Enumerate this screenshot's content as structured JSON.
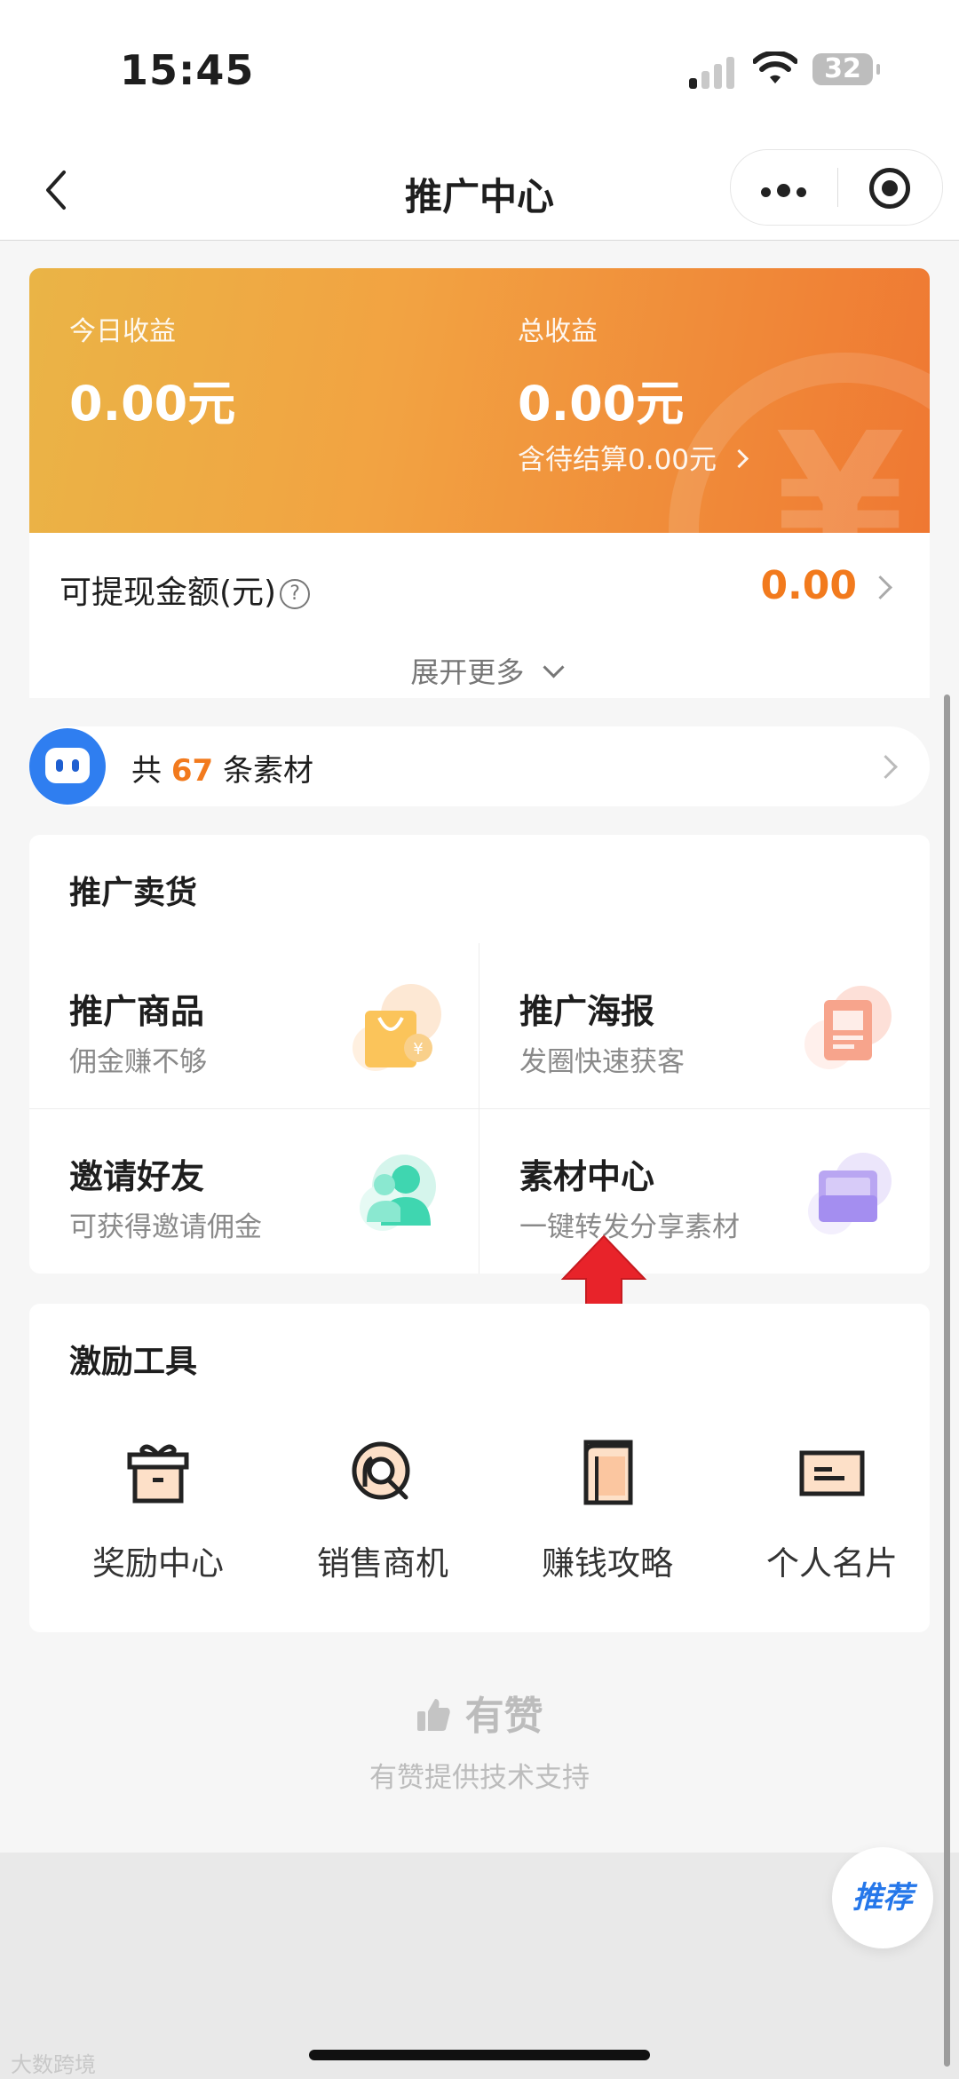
{
  "status_bar": {
    "time": "15:45",
    "battery": "32"
  },
  "nav": {
    "title": "推广中心"
  },
  "earnings": {
    "today_label": "今日收益",
    "today_value": "0.00元",
    "total_label": "总收益",
    "total_value": "0.00元",
    "pending_text": "含待结算0.00元"
  },
  "withdraw": {
    "label": "可提现金额(元)",
    "help": "?",
    "value": "0.00",
    "expand_label": "展开更多"
  },
  "material_bar": {
    "prefix": "共",
    "count": "67",
    "suffix": "条素材"
  },
  "sell": {
    "title": "推广卖货",
    "items": [
      {
        "title": "推广商品",
        "subtitle": "佣金赚不够",
        "icon": "shopping-bag-icon"
      },
      {
        "title": "推广海报",
        "subtitle": "发圈快速获客",
        "icon": "poster-icon"
      },
      {
        "title": "邀请好友",
        "subtitle": "可获得邀请佣金",
        "icon": "friends-icon"
      },
      {
        "title": "素材中心",
        "subtitle": "一键转发分享素材",
        "icon": "folder-icon"
      }
    ]
  },
  "tools": {
    "title": "激励工具",
    "items": [
      {
        "label": "奖励中心",
        "icon": "gift-icon"
      },
      {
        "label": "销售商机",
        "icon": "search-target-icon"
      },
      {
        "label": "赚钱攻略",
        "icon": "book-icon"
      },
      {
        "label": "个人名片",
        "icon": "card-icon"
      }
    ]
  },
  "footer": {
    "brand": "有赞",
    "support": "有赞提供技术支持"
  },
  "floating": {
    "recommend": "推荐"
  },
  "watermark": "大数跨境",
  "colors": {
    "accent": "#f27a1d",
    "banner_start": "#eab446",
    "banner_end": "#ef7832",
    "recommend_blue": "#2577ea",
    "arrow_red": "#e8232a"
  }
}
